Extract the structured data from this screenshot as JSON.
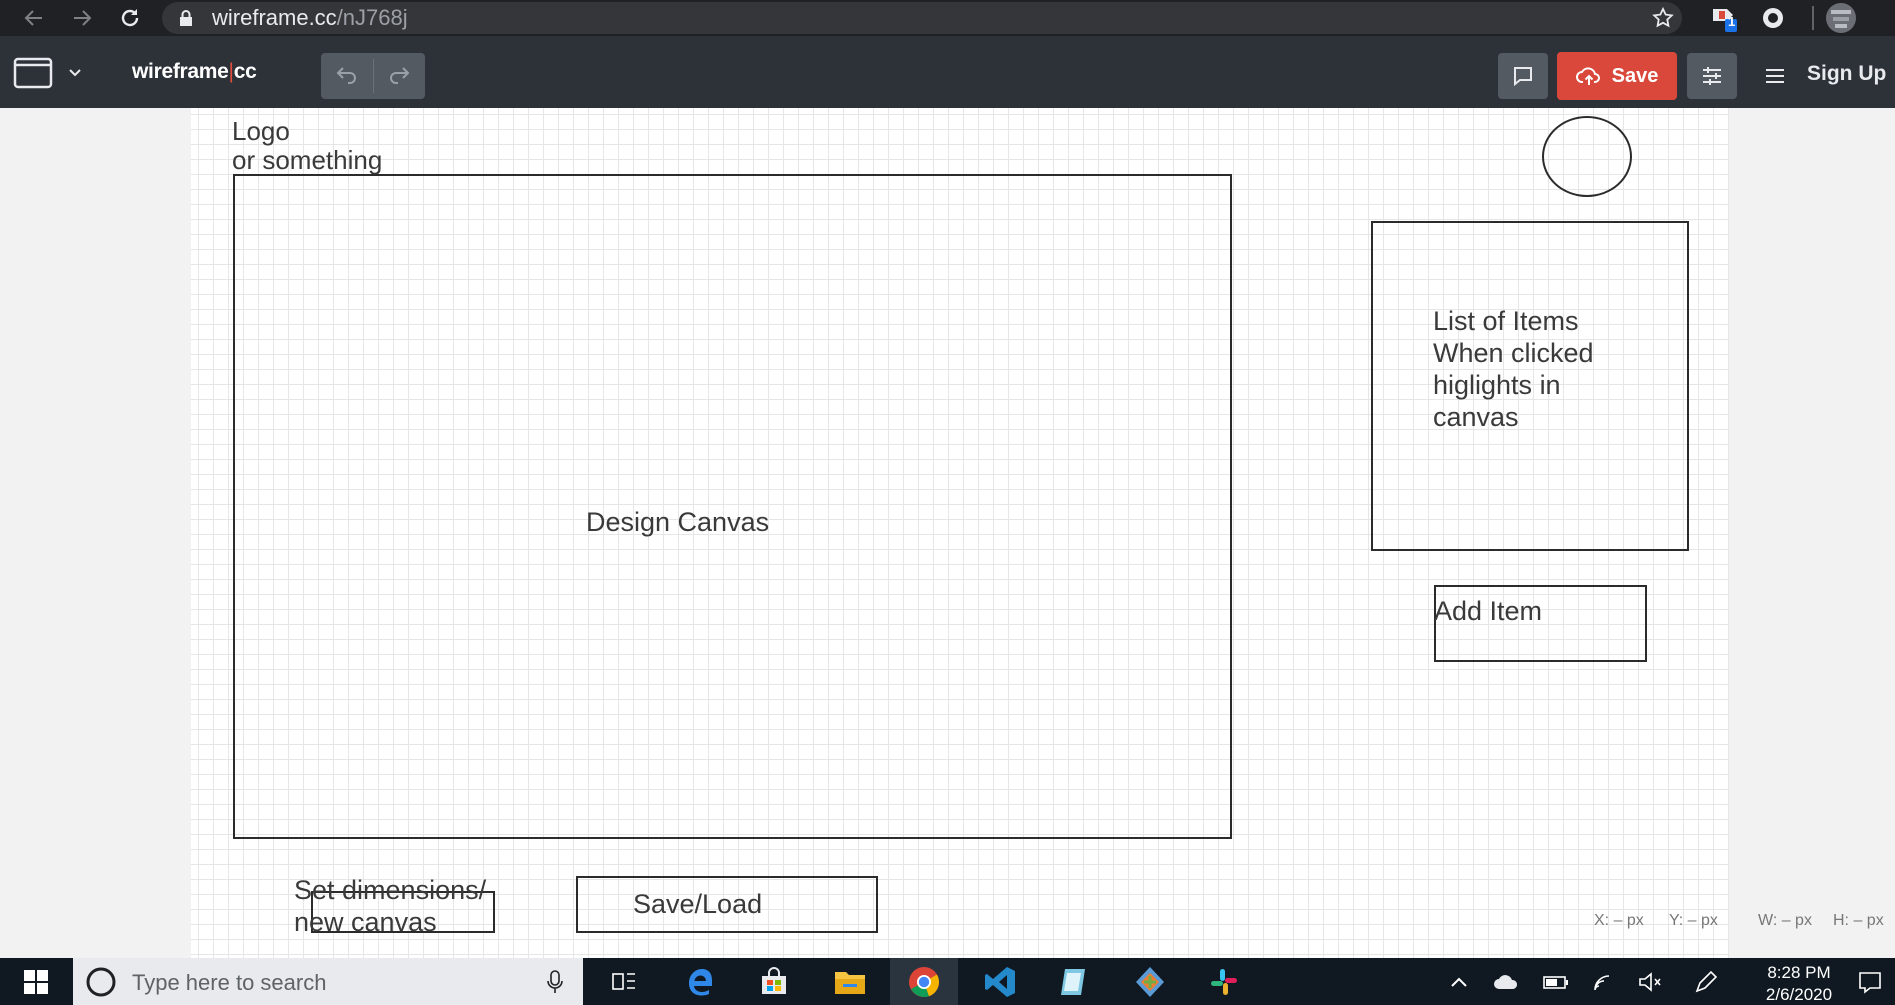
{
  "browser": {
    "url_domain": "wireframe.cc",
    "url_path": "/nJ768j",
    "notification_badge": "1"
  },
  "app": {
    "brand_left": "wireframe",
    "brand_sep": "|",
    "brand_right": "cc",
    "save_label": "Save",
    "signup_label": "Sign Up"
  },
  "canvas": {
    "logo_text": "Logo\nor something",
    "design_canvas_label": "Design Canvas",
    "list_text": "List of Items\nWhen clicked\nhiglights in\ncanvas",
    "add_item_label": "Add Item",
    "set_dimensions_text": "Set dimensions/\nnew canvas",
    "save_load_label": "Save/Load"
  },
  "status": {
    "x": "X: – px",
    "y": "Y: – px",
    "w": "W: – px",
    "h": "H: – px"
  },
  "taskbar": {
    "search_placeholder": "Type here to search",
    "time": "8:28 PM",
    "date": "2/6/2020"
  }
}
